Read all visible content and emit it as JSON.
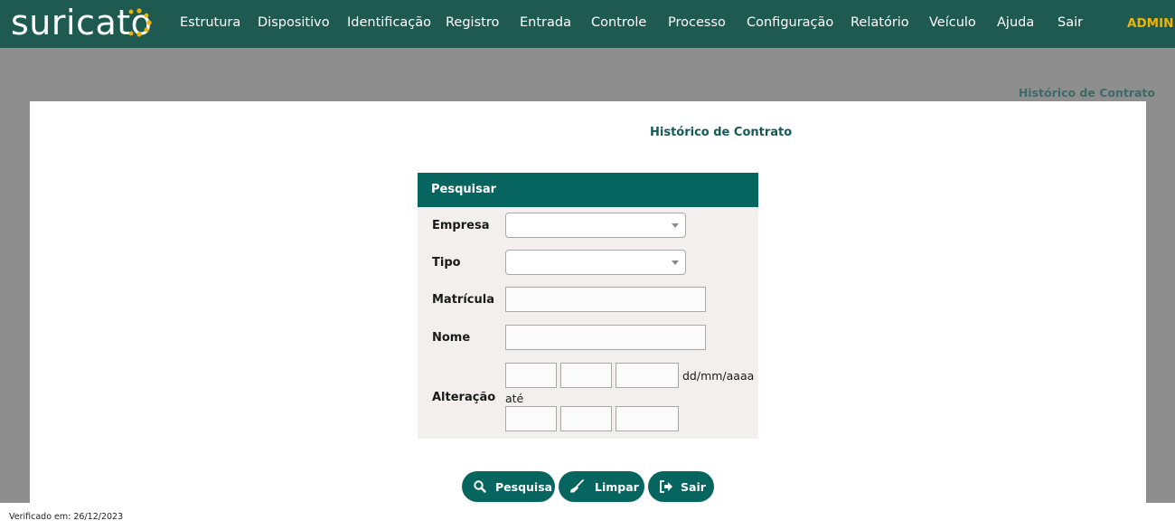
{
  "app": {
    "logo_text": "suricato",
    "user": "ADMIN",
    "colors": {
      "header": "#1e5a50",
      "accent": "#06655f",
      "logo_dots": "#f0b400",
      "admin": "#f0b400"
    }
  },
  "nav": {
    "items": [
      "Estrutura",
      "Dispositivo",
      "Identificação",
      "Registro",
      "Entrada",
      "Controle",
      "Processo",
      "Configuração",
      "Relatório",
      "Veículo",
      "Ajuda",
      "Sair"
    ]
  },
  "breadcrumb": "Histórico de Contrato",
  "page": {
    "title": "Histórico de Contrato"
  },
  "form": {
    "header": "Pesquisar",
    "fields": {
      "empresa": {
        "label": "Empresa",
        "value": ""
      },
      "tipo": {
        "label": "Tipo",
        "value": ""
      },
      "matricula": {
        "label": "Matrícula",
        "value": ""
      },
      "nome": {
        "label": "Nome",
        "value": ""
      },
      "alteracao": {
        "label": "Alteração",
        "date_format_hint": "dd/mm/aaaa",
        "range_sep": "até"
      }
    }
  },
  "buttons": {
    "pesquisa": {
      "label": "Pesquisa",
      "icon": "search-icon"
    },
    "limpar": {
      "label": "Limpar",
      "icon": "broom-icon"
    },
    "sair": {
      "label": "Sair",
      "icon": "sign-out-icon"
    }
  },
  "footer": {
    "verified": "Verificado em: 26/12/2023"
  }
}
